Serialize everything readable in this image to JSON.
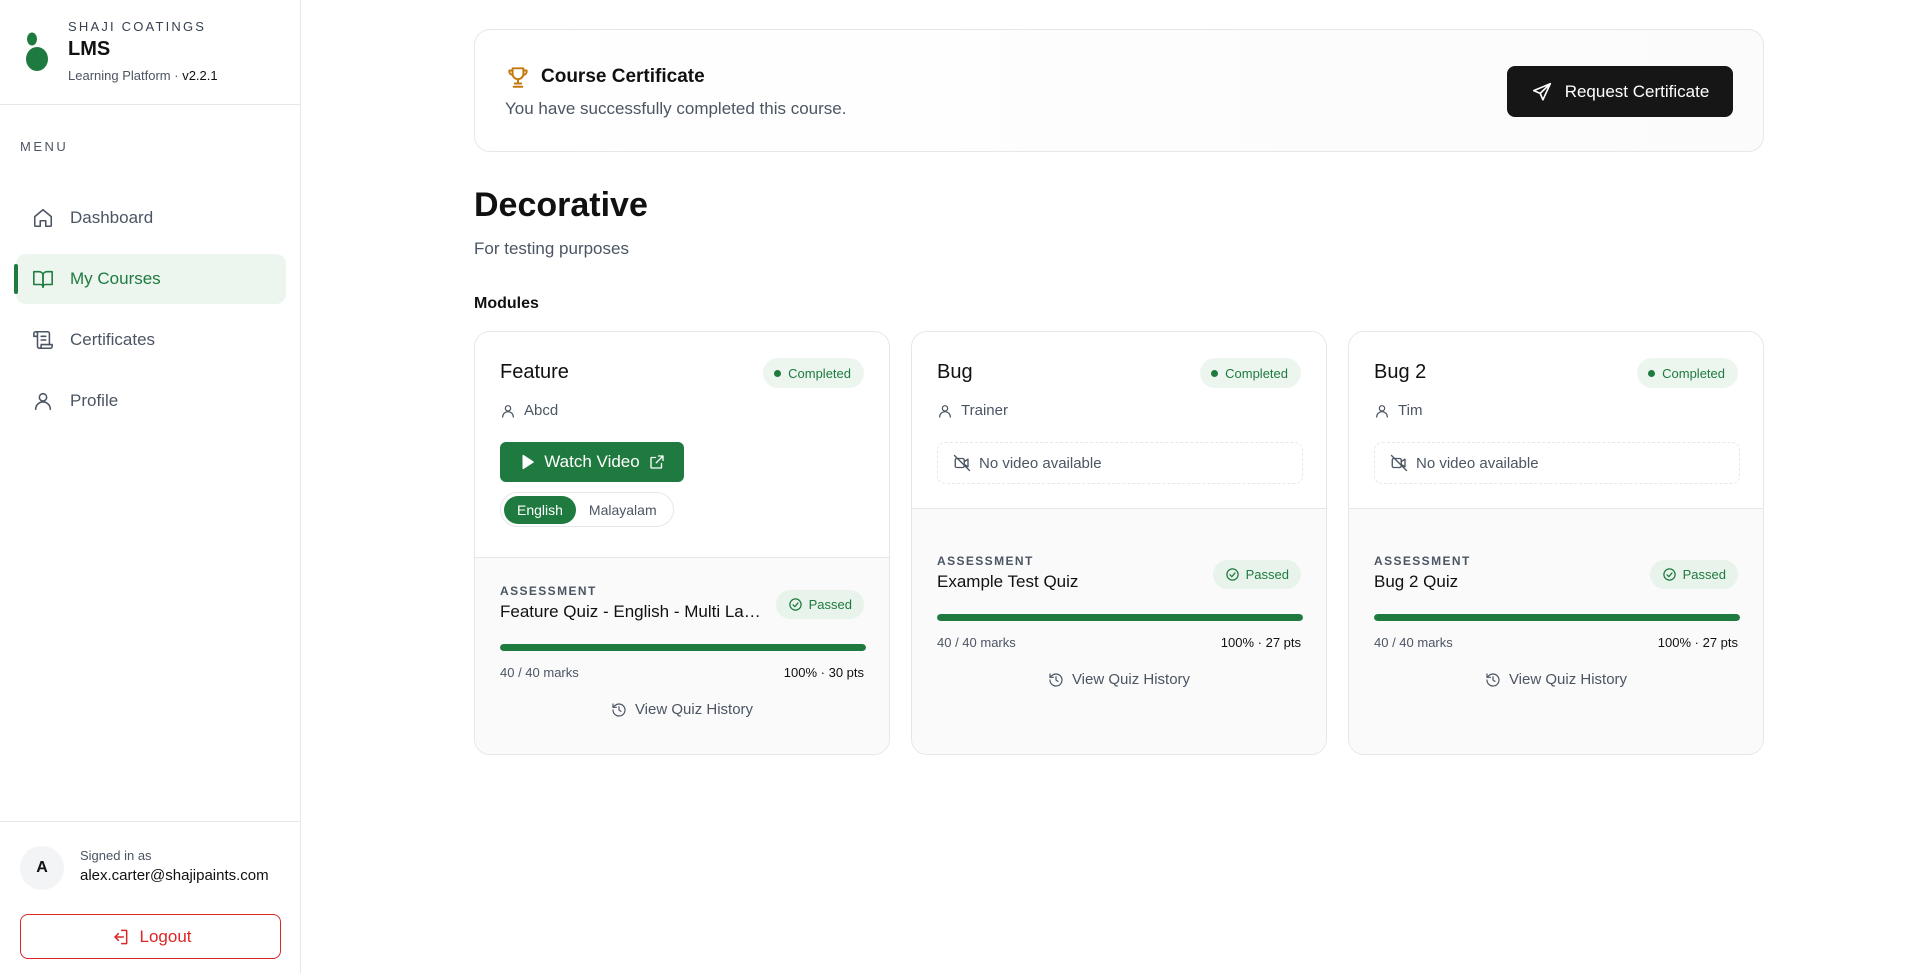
{
  "brand": {
    "company": "SHAJI COATINGS",
    "app": "LMS",
    "subtitle": "Learning Platform ·",
    "version": "v2.2.1",
    "accent": "#1f7a3f"
  },
  "sidebar": {
    "menu_label": "MENU",
    "items": [
      {
        "label": "Dashboard",
        "icon": "home-icon",
        "active": false
      },
      {
        "label": "My Courses",
        "icon": "book-open-icon",
        "active": true
      },
      {
        "label": "Certificates",
        "icon": "scroll-icon",
        "active": false
      },
      {
        "label": "Profile",
        "icon": "user-icon",
        "active": false
      }
    ],
    "footer": {
      "avatar_initial": "A",
      "signed_in_label": "Signed in as",
      "email": "alex.carter@shajipaints.com",
      "logout_label": "Logout"
    }
  },
  "certificate": {
    "title": "Course Certificate",
    "subtitle": "You have successfully completed this course.",
    "button": "Request Certificate"
  },
  "course": {
    "title": "Decorative",
    "description": "For testing purposes",
    "modules_label": "Modules"
  },
  "modules": [
    {
      "name": "Feature",
      "status": "Completed",
      "trainer": "Abcd",
      "video_button": "Watch Video",
      "languages": [
        "English",
        "Malayalam"
      ],
      "selected_language": "English",
      "assessment_label": "ASSESSMENT",
      "quiz": "Feature Quiz - English - Multi Language",
      "quiz_status": "Passed",
      "progress": 1.0,
      "marks": "40 / 40 marks",
      "score": "100% · 30 pts",
      "history": "View Quiz History"
    },
    {
      "name": "Bug",
      "status": "Completed",
      "trainer": "Trainer",
      "no_video": "No video available",
      "assessment_label": "ASSESSMENT",
      "quiz": "Example Test Quiz",
      "quiz_status": "Passed",
      "progress": 1.0,
      "marks": "40 / 40 marks",
      "score": "100% · 27 pts",
      "history": "View Quiz History"
    },
    {
      "name": "Bug 2",
      "status": "Completed",
      "trainer": "Tim",
      "no_video": "No video available",
      "assessment_label": "ASSESSMENT",
      "quiz": "Bug 2 Quiz",
      "quiz_status": "Passed",
      "progress": 1.0,
      "marks": "40 / 40 marks",
      "score": "100% · 27 pts",
      "history": "View Quiz History"
    }
  ]
}
